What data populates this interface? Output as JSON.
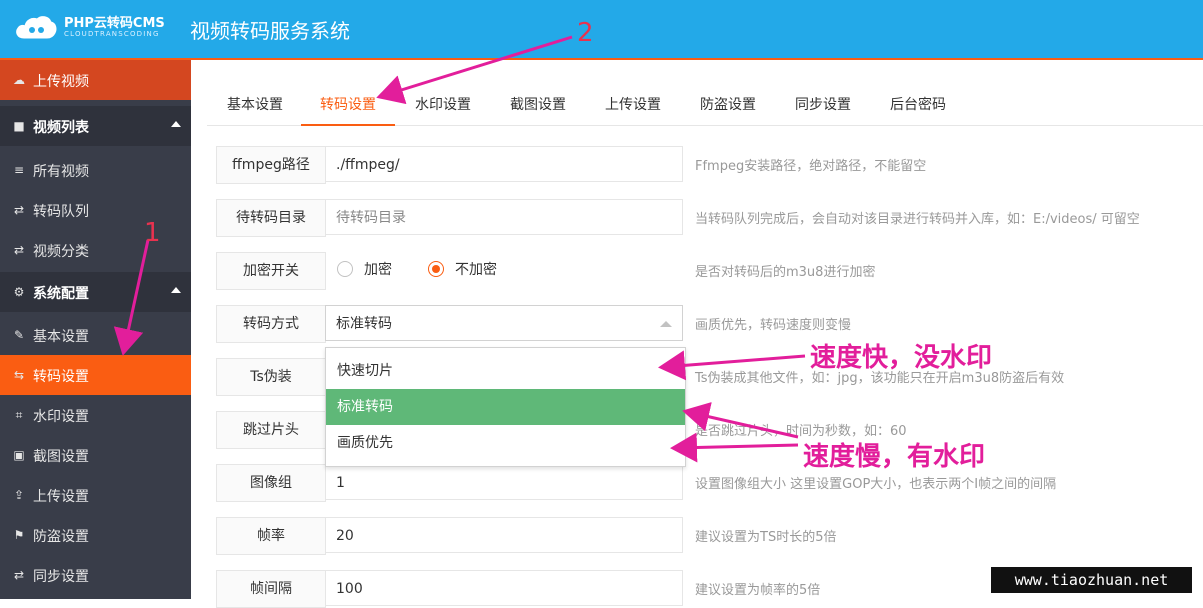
{
  "header": {
    "logo_brand": "PHP云转码CMS",
    "logo_sub": "CLOUDTRANSCODING",
    "system_title": "视频转码服务系统"
  },
  "sidebar": {
    "upload": "上传视频",
    "video_group": "视频列表",
    "video_items": [
      "所有视频",
      "转码队列",
      "视频分类"
    ],
    "config_group": "系统配置",
    "config_items": [
      "基本设置",
      "转码设置",
      "水印设置",
      "截图设置",
      "上传设置",
      "防盗设置",
      "同步设置"
    ],
    "active": "转码设置"
  },
  "tabs": [
    "基本设置",
    "转码设置",
    "水印设置",
    "截图设置",
    "上传设置",
    "防盗设置",
    "同步设置",
    "后台密码"
  ],
  "active_tab": "转码设置",
  "form": {
    "ffmpeg": {
      "label": "ffmpeg路径",
      "value": "./ffmpeg/",
      "hint": "Ffmpeg安装路径，绝对路径，不能留空"
    },
    "queue_dir": {
      "label": "待转码目录",
      "placeholder": "待转码目录",
      "hint": "当转码队列完成后，会自动对该目录进行转码并入库，如：E:/videos/ 可留空"
    },
    "encrypt": {
      "label": "加密开关",
      "options": [
        "加密",
        "不加密"
      ],
      "selected": "不加密",
      "hint": "是否对转码后的m3u8进行加密"
    },
    "mode": {
      "label": "转码方式",
      "value": "标准转码",
      "hint": "画质优先，转码速度则变慢"
    },
    "ts": {
      "label": "Ts伪装",
      "hint": "Ts伪装成其他文件，如：jpg，该功能只在开启m3u8防盗后有效"
    },
    "skip": {
      "label": "跳过片头",
      "hint": "是否跳过片头，时间为秒数，如：60"
    },
    "gop": {
      "label": "图像组",
      "value": "1",
      "hint": "设置图像组大小 这里设置GOP大小，也表示两个I帧之间的间隔"
    },
    "fps": {
      "label": "帧率",
      "value": "20",
      "hint": "建议设置为TS时长的5倍"
    },
    "interval": {
      "label": "帧间隔",
      "value": "100",
      "hint": "建议设置为帧率的5倍"
    }
  },
  "dropdown": {
    "options": [
      "快速切片",
      "标准转码",
      "画质优先"
    ],
    "selected": "标准转码"
  },
  "annotations": {
    "num1": "1",
    "num2": "2",
    "fast": "速度快，没水印",
    "slow": "速度慢，有水印",
    "color": "#e21e9b"
  },
  "watermark": "www.tiaozhuan.net",
  "colors": {
    "header": "#23a9e8",
    "accent": "#fa5d12",
    "sidebar": "#393d49",
    "selected_option": "#5fb878"
  }
}
